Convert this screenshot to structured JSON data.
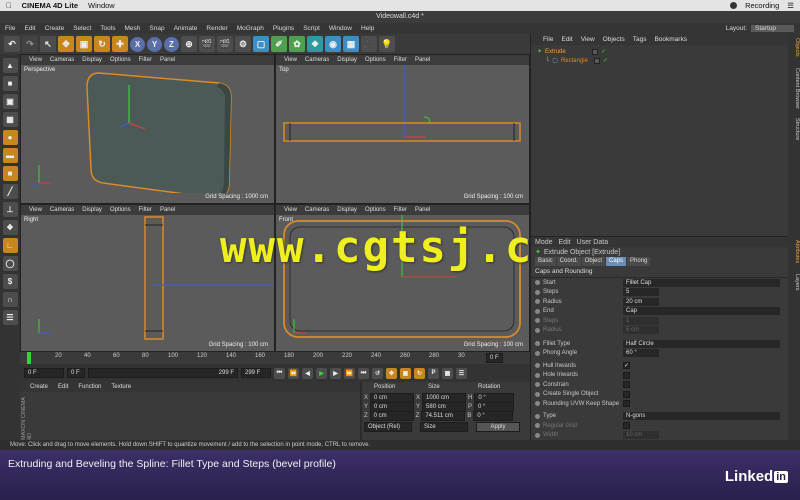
{
  "mac_menubar": {
    "app": "CINEMA 4D Lite",
    "window": "Window",
    "recording": "Recording"
  },
  "c4d": {
    "title": "Videowall.c4d *",
    "menu": [
      "File",
      "Edit",
      "Create",
      "Select",
      "Tools",
      "Mesh",
      "Snap",
      "Animate",
      "Render",
      "MoGraph",
      "Plugins",
      "Script",
      "Window",
      "Help"
    ],
    "layout_label": "Layout:",
    "layout_value": "Startup"
  },
  "toolbar": {
    "axes": [
      "X",
      "Y",
      "Z"
    ]
  },
  "viewports": {
    "menu": [
      "View",
      "Cameras",
      "Display",
      "Options",
      "Filter",
      "Panel"
    ],
    "perspective": {
      "label": "Perspective",
      "grid": "Grid Spacing : 1000 cm"
    },
    "top": {
      "label": "Top",
      "grid": "Grid Spacing : 100 cm"
    },
    "right": {
      "label": "Right",
      "grid": "Grid Spacing : 100 cm"
    },
    "front": {
      "label": "Front",
      "grid": "Grid Spacing : 100 cm"
    }
  },
  "timeline": {
    "ticks": [
      "0",
      "20",
      "40",
      "60",
      "80",
      "100",
      "120",
      "140",
      "160",
      "180",
      "200",
      "220",
      "240",
      "260",
      "280",
      "30"
    ],
    "end_frame": "0 F",
    "current": "0 F",
    "min": "0 F",
    "max": "299 F",
    "max2": "299 F"
  },
  "material_manager": {
    "menu": [
      "Create",
      "Edit",
      "Function",
      "Texture"
    ],
    "brand": "MAXON CINEMA 4D"
  },
  "coordinates": {
    "headers": [
      "Position",
      "Size",
      "Rotation"
    ],
    "rows": [
      {
        "axis": "X",
        "pos": "0 cm",
        "size": "1000 cm",
        "rot_axis": "H",
        "rot": "0 °"
      },
      {
        "axis": "Y",
        "pos": "0 cm",
        "size": "580 cm",
        "rot_axis": "P",
        "rot": "0 °"
      },
      {
        "axis": "Z",
        "pos": "0 cm",
        "size": "74.511 cm",
        "rot_axis": "B",
        "rot": "0 °"
      }
    ],
    "mode": "Object (Rel)",
    "size_mode": "Size",
    "apply": "Apply"
  },
  "object_manager": {
    "menu": [
      "File",
      "Edit",
      "View",
      "Objects",
      "Tags",
      "Bookmarks"
    ],
    "objects": [
      {
        "name": "Extrude",
        "indent": 0
      },
      {
        "name": "Rectangle",
        "indent": 1
      }
    ]
  },
  "attribute_manager": {
    "mode_label": "Mode",
    "edit_label": "Edit",
    "userdata_label": "User Data",
    "object_title": "Extrude Object [Extrude]",
    "tabs": [
      "Basic",
      "Coord.",
      "Object",
      "Caps",
      "Phong"
    ],
    "active_tab": "Caps",
    "section": "Caps and Rounding",
    "rows": [
      {
        "label": "Start",
        "value": "Fillet Cap",
        "dropdown": true,
        "disabled": false
      },
      {
        "label": "Steps",
        "value": "5",
        "disabled": false
      },
      {
        "label": "Radius",
        "value": "20 cm",
        "disabled": false
      },
      {
        "label": "End",
        "value": "Cap",
        "dropdown": true,
        "disabled": false
      },
      {
        "label": "Steps",
        "value": "1",
        "disabled": true
      },
      {
        "label": "Radius",
        "value": "5 cm",
        "disabled": true
      }
    ],
    "rows2": [
      {
        "label": "Fillet Type",
        "value": "Half Circle",
        "dropdown": true
      },
      {
        "label": "Phong Angle",
        "value": "60 °"
      }
    ],
    "checks": [
      {
        "label": "Hull Inwards",
        "checked": true
      },
      {
        "label": "Hole Inwards",
        "checked": false
      },
      {
        "label": "Constrain",
        "checked": false
      },
      {
        "label": "Create Single Object",
        "checked": false
      },
      {
        "label": "Rounding UVW Keep Shape",
        "checked": false
      }
    ],
    "type_label": "Type",
    "type_value": "N-gons",
    "regular_grid": "Regular Grid",
    "width_label": "Width",
    "width_value": "10 cm"
  },
  "vertical_tabs": [
    "Objects",
    "Content Browser",
    "Structure",
    "Attributes",
    "Layers"
  ],
  "status": "Move: Click and drag to move elements. Hold down SHIFT to quantize movement / add to the selection in point mode, CTRL to remove.",
  "caption": "Extruding and Beveling the Spline: Fillet Type and Steps (bevel profile)",
  "brand": {
    "linked": "Linked",
    "in": "in"
  },
  "watermark": "www.cgtsj.com",
  "colors": {
    "accent": "#6b8fb4",
    "spline": "#d98b28",
    "watermark": "#f0ef1e",
    "caption_bar": "#2a1f4d"
  }
}
